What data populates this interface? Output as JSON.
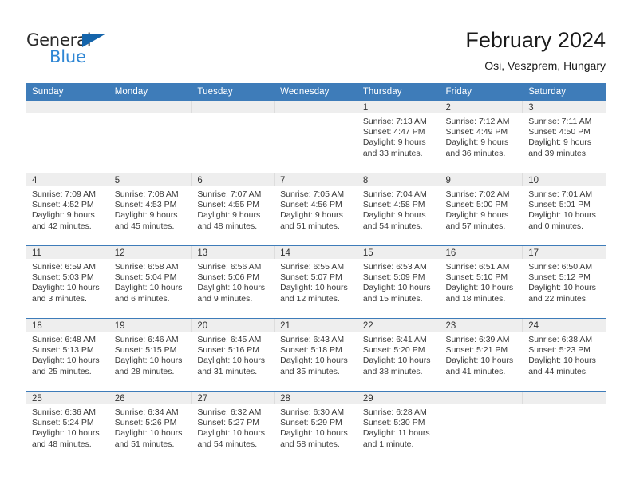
{
  "brand": {
    "name_part1": "General",
    "name_part2": "Blue",
    "accent_color": "#2e86d4",
    "triangle_color": "#1565ab"
  },
  "header": {
    "title": "February 2024",
    "subtitle": "Osi, Veszprem, Hungary",
    "header_bg_color": "#3e7cb9",
    "date_band_color": "#eeeeee"
  },
  "weekdays": [
    "Sunday",
    "Monday",
    "Tuesday",
    "Wednesday",
    "Thursday",
    "Friday",
    "Saturday"
  ],
  "labels": {
    "sunrise_prefix": "Sunrise:",
    "sunset_prefix": "Sunset:",
    "daylight_prefix": "Daylight:"
  },
  "weeks": [
    [
      {
        "day": "",
        "empty": true
      },
      {
        "day": "",
        "empty": true
      },
      {
        "day": "",
        "empty": true
      },
      {
        "day": "",
        "empty": true
      },
      {
        "day": "1",
        "l1": "Sunrise: 7:13 AM",
        "l2": "Sunset: 4:47 PM",
        "l3": "Daylight: 9 hours",
        "l4": "and 33 minutes."
      },
      {
        "day": "2",
        "l1": "Sunrise: 7:12 AM",
        "l2": "Sunset: 4:49 PM",
        "l3": "Daylight: 9 hours",
        "l4": "and 36 minutes."
      },
      {
        "day": "3",
        "l1": "Sunrise: 7:11 AM",
        "l2": "Sunset: 4:50 PM",
        "l3": "Daylight: 9 hours",
        "l4": "and 39 minutes."
      }
    ],
    [
      {
        "day": "4",
        "l1": "Sunrise: 7:09 AM",
        "l2": "Sunset: 4:52 PM",
        "l3": "Daylight: 9 hours",
        "l4": "and 42 minutes."
      },
      {
        "day": "5",
        "l1": "Sunrise: 7:08 AM",
        "l2": "Sunset: 4:53 PM",
        "l3": "Daylight: 9 hours",
        "l4": "and 45 minutes."
      },
      {
        "day": "6",
        "l1": "Sunrise: 7:07 AM",
        "l2": "Sunset: 4:55 PM",
        "l3": "Daylight: 9 hours",
        "l4": "and 48 minutes."
      },
      {
        "day": "7",
        "l1": "Sunrise: 7:05 AM",
        "l2": "Sunset: 4:56 PM",
        "l3": "Daylight: 9 hours",
        "l4": "and 51 minutes."
      },
      {
        "day": "8",
        "l1": "Sunrise: 7:04 AM",
        "l2": "Sunset: 4:58 PM",
        "l3": "Daylight: 9 hours",
        "l4": "and 54 minutes."
      },
      {
        "day": "9",
        "l1": "Sunrise: 7:02 AM",
        "l2": "Sunset: 5:00 PM",
        "l3": "Daylight: 9 hours",
        "l4": "and 57 minutes."
      },
      {
        "day": "10",
        "l1": "Sunrise: 7:01 AM",
        "l2": "Sunset: 5:01 PM",
        "l3": "Daylight: 10 hours",
        "l4": "and 0 minutes."
      }
    ],
    [
      {
        "day": "11",
        "l1": "Sunrise: 6:59 AM",
        "l2": "Sunset: 5:03 PM",
        "l3": "Daylight: 10 hours",
        "l4": "and 3 minutes."
      },
      {
        "day": "12",
        "l1": "Sunrise: 6:58 AM",
        "l2": "Sunset: 5:04 PM",
        "l3": "Daylight: 10 hours",
        "l4": "and 6 minutes."
      },
      {
        "day": "13",
        "l1": "Sunrise: 6:56 AM",
        "l2": "Sunset: 5:06 PM",
        "l3": "Daylight: 10 hours",
        "l4": "and 9 minutes."
      },
      {
        "day": "14",
        "l1": "Sunrise: 6:55 AM",
        "l2": "Sunset: 5:07 PM",
        "l3": "Daylight: 10 hours",
        "l4": "and 12 minutes."
      },
      {
        "day": "15",
        "l1": "Sunrise: 6:53 AM",
        "l2": "Sunset: 5:09 PM",
        "l3": "Daylight: 10 hours",
        "l4": "and 15 minutes."
      },
      {
        "day": "16",
        "l1": "Sunrise: 6:51 AM",
        "l2": "Sunset: 5:10 PM",
        "l3": "Daylight: 10 hours",
        "l4": "and 18 minutes."
      },
      {
        "day": "17",
        "l1": "Sunrise: 6:50 AM",
        "l2": "Sunset: 5:12 PM",
        "l3": "Daylight: 10 hours",
        "l4": "and 22 minutes."
      }
    ],
    [
      {
        "day": "18",
        "l1": "Sunrise: 6:48 AM",
        "l2": "Sunset: 5:13 PM",
        "l3": "Daylight: 10 hours",
        "l4": "and 25 minutes."
      },
      {
        "day": "19",
        "l1": "Sunrise: 6:46 AM",
        "l2": "Sunset: 5:15 PM",
        "l3": "Daylight: 10 hours",
        "l4": "and 28 minutes."
      },
      {
        "day": "20",
        "l1": "Sunrise: 6:45 AM",
        "l2": "Sunset: 5:16 PM",
        "l3": "Daylight: 10 hours",
        "l4": "and 31 minutes."
      },
      {
        "day": "21",
        "l1": "Sunrise: 6:43 AM",
        "l2": "Sunset: 5:18 PM",
        "l3": "Daylight: 10 hours",
        "l4": "and 35 minutes."
      },
      {
        "day": "22",
        "l1": "Sunrise: 6:41 AM",
        "l2": "Sunset: 5:20 PM",
        "l3": "Daylight: 10 hours",
        "l4": "and 38 minutes."
      },
      {
        "day": "23",
        "l1": "Sunrise: 6:39 AM",
        "l2": "Sunset: 5:21 PM",
        "l3": "Daylight: 10 hours",
        "l4": "and 41 minutes."
      },
      {
        "day": "24",
        "l1": "Sunrise: 6:38 AM",
        "l2": "Sunset: 5:23 PM",
        "l3": "Daylight: 10 hours",
        "l4": "and 44 minutes."
      }
    ],
    [
      {
        "day": "25",
        "l1": "Sunrise: 6:36 AM",
        "l2": "Sunset: 5:24 PM",
        "l3": "Daylight: 10 hours",
        "l4": "and 48 minutes."
      },
      {
        "day": "26",
        "l1": "Sunrise: 6:34 AM",
        "l2": "Sunset: 5:26 PM",
        "l3": "Daylight: 10 hours",
        "l4": "and 51 minutes."
      },
      {
        "day": "27",
        "l1": "Sunrise: 6:32 AM",
        "l2": "Sunset: 5:27 PM",
        "l3": "Daylight: 10 hours",
        "l4": "and 54 minutes."
      },
      {
        "day": "28",
        "l1": "Sunrise: 6:30 AM",
        "l2": "Sunset: 5:29 PM",
        "l3": "Daylight: 10 hours",
        "l4": "and 58 minutes."
      },
      {
        "day": "29",
        "l1": "Sunrise: 6:28 AM",
        "l2": "Sunset: 5:30 PM",
        "l3": "Daylight: 11 hours",
        "l4": "and 1 minute."
      },
      {
        "day": "",
        "empty": true
      },
      {
        "day": "",
        "empty": true
      }
    ]
  ]
}
